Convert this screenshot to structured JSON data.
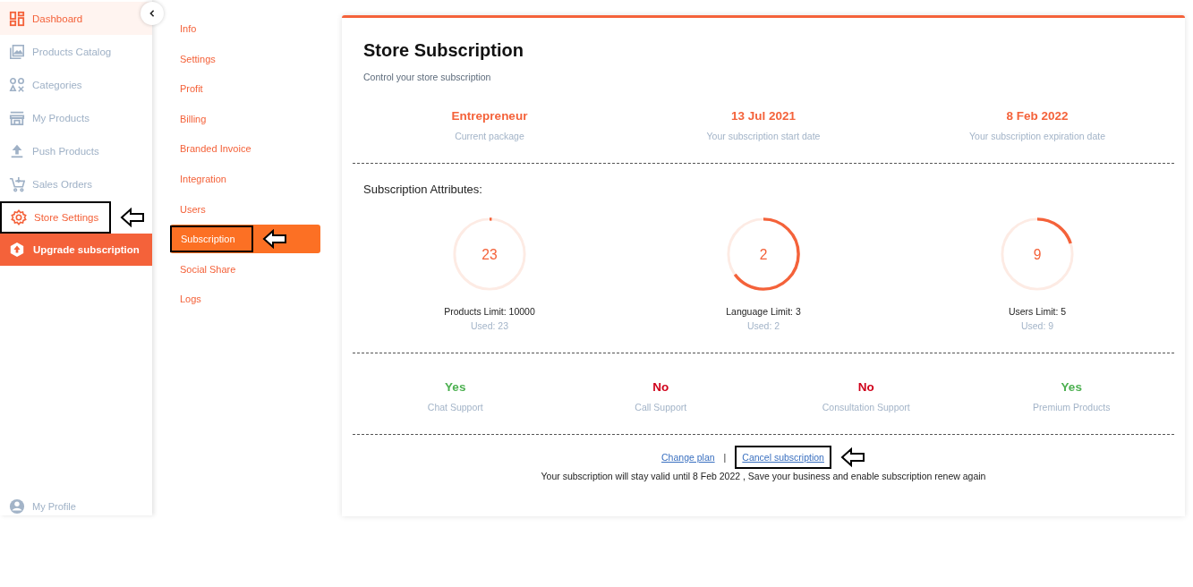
{
  "sidebar": {
    "items": [
      {
        "label": "Dashboard",
        "selected": true,
        "annotated": false
      },
      {
        "label": "Products Catalog",
        "selected": false,
        "annotated": false
      },
      {
        "label": "Categories",
        "selected": false,
        "annotated": false
      },
      {
        "label": "My Products",
        "selected": false,
        "annotated": false
      },
      {
        "label": "Push Products",
        "selected": false,
        "annotated": false
      },
      {
        "label": "Sales Orders",
        "selected": false,
        "annotated": false
      },
      {
        "label": "Store Settings",
        "selected": false,
        "annotated": true
      }
    ],
    "upgrade": {
      "label": "Upgrade subscription"
    },
    "profile": {
      "label": "My Profile"
    }
  },
  "submenu": {
    "items": [
      {
        "label": "Info",
        "selected": false,
        "annotated": false
      },
      {
        "label": "Settings",
        "selected": false,
        "annotated": false
      },
      {
        "label": "Profit",
        "selected": false,
        "annotated": false
      },
      {
        "label": "Billing",
        "selected": false,
        "annotated": false
      },
      {
        "label": "Branded Invoice",
        "selected": false,
        "annotated": false
      },
      {
        "label": "Integration",
        "selected": false,
        "annotated": false
      },
      {
        "label": "Users",
        "selected": false,
        "annotated": false
      },
      {
        "label": "Subscription",
        "selected": true,
        "annotated": true
      },
      {
        "label": "Social Share",
        "selected": false,
        "annotated": false
      },
      {
        "label": "Logs",
        "selected": false,
        "annotated": false
      }
    ]
  },
  "card": {
    "title": "Store Subscription",
    "subtitle": "Control your store subscription",
    "summary": [
      {
        "value": "Entrepreneur",
        "label": "Current package"
      },
      {
        "value": "13 Jul 2021",
        "label": "Your subscription start date"
      },
      {
        "value": "8 Feb 2022",
        "label": "Your subscription expiration date"
      }
    ],
    "attributes_title": "Subscription Attributes:",
    "attributes": [
      {
        "count": "23",
        "limit": "Products Limit: 10000",
        "used": "Used: 23",
        "level": 0.01
      },
      {
        "count": "2",
        "limit": "Language Limit: 3",
        "used": "Used: 2",
        "level": 0.65
      },
      {
        "count": "9",
        "limit": "Users Limit: 5",
        "used": "Used: 9",
        "level": 0.2
      }
    ],
    "features": [
      {
        "value": "Yes",
        "label": "Chat Support",
        "available": true
      },
      {
        "value": "No",
        "label": "Call Support",
        "available": false
      },
      {
        "value": "No",
        "label": "Consultation Support",
        "available": false
      },
      {
        "value": "Yes",
        "label": "Premium Products",
        "available": true
      }
    ],
    "links": [
      {
        "label": "Change plan",
        "annotated": false
      },
      {
        "label": "Cancel subscription",
        "annotated": true
      }
    ],
    "separator": "|",
    "note": "Your subscription will stay valid until 8 Feb 2022 , Save your business and enable subscription renew again"
  }
}
